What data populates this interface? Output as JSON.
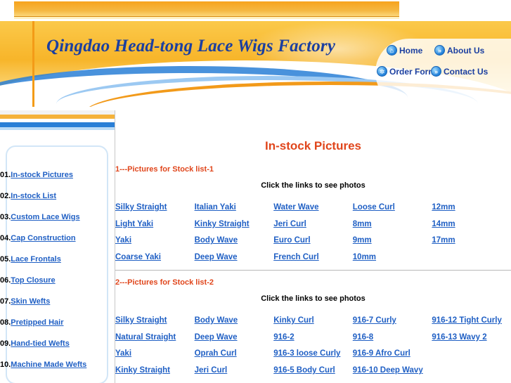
{
  "header": {
    "site_title": "Qingdao Head-tong Lace Wigs Factory",
    "nav": [
      {
        "label": "Home",
        "icon": "home-icon"
      },
      {
        "label": "About Us",
        "icon": "chevron-right-icon"
      },
      {
        "label": "Order Form",
        "icon": "gear-icon"
      },
      {
        "label": "Contact Us",
        "icon": "chevron-right-icon"
      }
    ]
  },
  "sidebar": {
    "items": [
      {
        "num": "01.",
        "label": "In-stock Pictures"
      },
      {
        "num": "02.",
        "label": "In-stock List"
      },
      {
        "num": "03.",
        "label": "Custom Lace Wigs"
      },
      {
        "num": "04.",
        "label": "Cap Construction"
      },
      {
        "num": "05.",
        "label": "Lace Frontals"
      },
      {
        "num": "06.",
        "label": "Top Closure"
      },
      {
        "num": "07.",
        "label": "Skin Wefts"
      },
      {
        "num": "08.",
        "label": "Pretipped Hair"
      },
      {
        "num": "09.",
        "label": "Hand-tied Wefts"
      },
      {
        "num": "10.",
        "label": "Machine Made Wefts"
      }
    ]
  },
  "main": {
    "title": "In-stock Pictures",
    "sections": [
      {
        "title": "1---Pictures for Stock list-1",
        "hint": "Click the links to see photos",
        "links": [
          "Silky Straight",
          "Italian Yaki",
          "Water Wave",
          "Loose Curl",
          "12mm",
          "Light Yaki",
          "Kinky Straight",
          "Jeri Curl",
          "8mm",
          "14mm",
          "Yaki",
          "Body Wave",
          "Euro Curl",
          "9mm",
          "17mm",
          "Coarse Yaki",
          "Deep Wave",
          "French Curl",
          "10mm",
          ""
        ]
      },
      {
        "title": "2---Pictures for Stock list-2",
        "hint": "Click the links to see photos",
        "links": [
          "Silky Straight",
          "Body Wave",
          "Kinky Curl",
          "916-7 Curly",
          "916-12 Tight Curly",
          "Natural Straight",
          "Deep Wave",
          "916-2",
          "916-8",
          "916-13 Wavy 2",
          "Yaki",
          "Oprah Curl",
          "916-3 loose Curly",
          "916-9 Afro Curl",
          "",
          "Kinky Straight",
          "Jeri Curl",
          "916-5 Body Curl",
          "916-10 Deep Wavy",
          ""
        ]
      }
    ]
  },
  "colors": {
    "accent_orange": "#f5b740",
    "title_blue": "#1b3fa0",
    "link_blue": "#1f5fc4",
    "heading_red": "#e0461c"
  }
}
